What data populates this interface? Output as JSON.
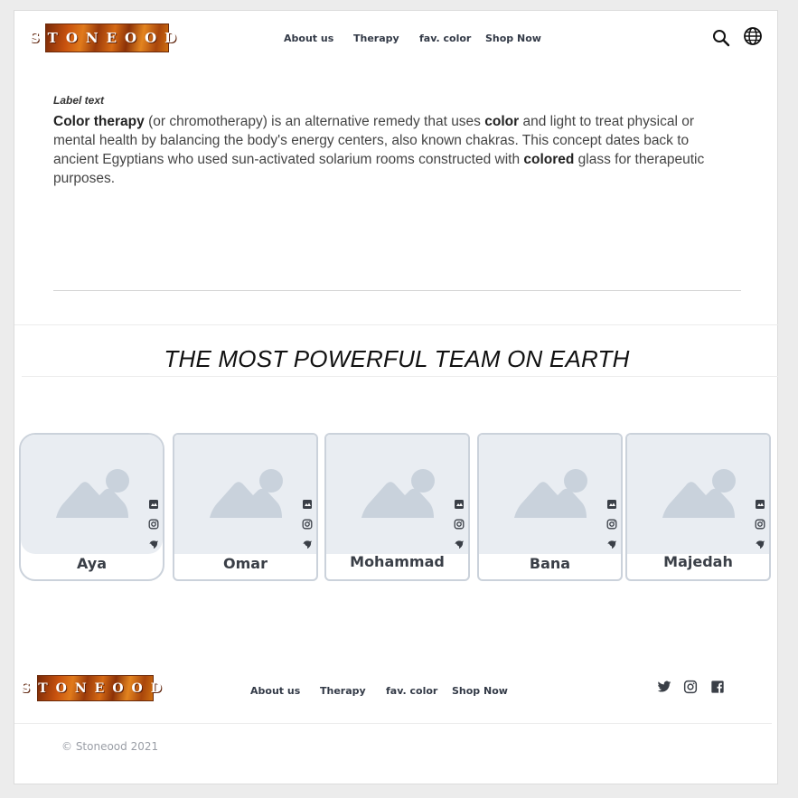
{
  "header": {
    "logo_text": "STONEOOD",
    "nav": [
      "About us",
      "Therapy",
      "fav. color",
      "Shop Now"
    ],
    "icons": [
      "search-icon",
      "globe-icon"
    ]
  },
  "content": {
    "label": "Label text",
    "p_b1": "Color therapy",
    "p_t1": " (or chromotherapy) is an alternative remedy that uses ",
    "p_b2": "color",
    "p_t2": " and light to treat physical or mental health by balancing the body's energy centers, also known chakras. This concept dates back to ancient Egyptians who used sun-activated solarium rooms constructed with ",
    "p_b3": "colored",
    "p_t3": " glass for therapeutic purposes."
  },
  "team": {
    "title": "THE MOST POWERFUL TEAM ON EARTH",
    "members": [
      {
        "name": "Aya"
      },
      {
        "name": "Omar"
      },
      {
        "name": "Mohammad"
      },
      {
        "name": "Bana"
      },
      {
        "name": "Majedah"
      }
    ],
    "card_social_icons": [
      "bookmark-icon",
      "instagram-icon",
      "bird-icon"
    ]
  },
  "footer": {
    "logo_text": "STONEOOD",
    "nav": [
      "About us",
      "Therapy",
      "fav. color",
      "Shop Now"
    ],
    "social_icons": [
      "twitter-icon",
      "instagram-icon",
      "facebook-icon"
    ],
    "copyright": "© Stoneood 2021"
  },
  "colors": {
    "text_dark": "#333a47",
    "placeholder_bg": "#e9edf2",
    "placeholder_shape": "#c9d2dc",
    "card_border": "#cbd2db"
  }
}
